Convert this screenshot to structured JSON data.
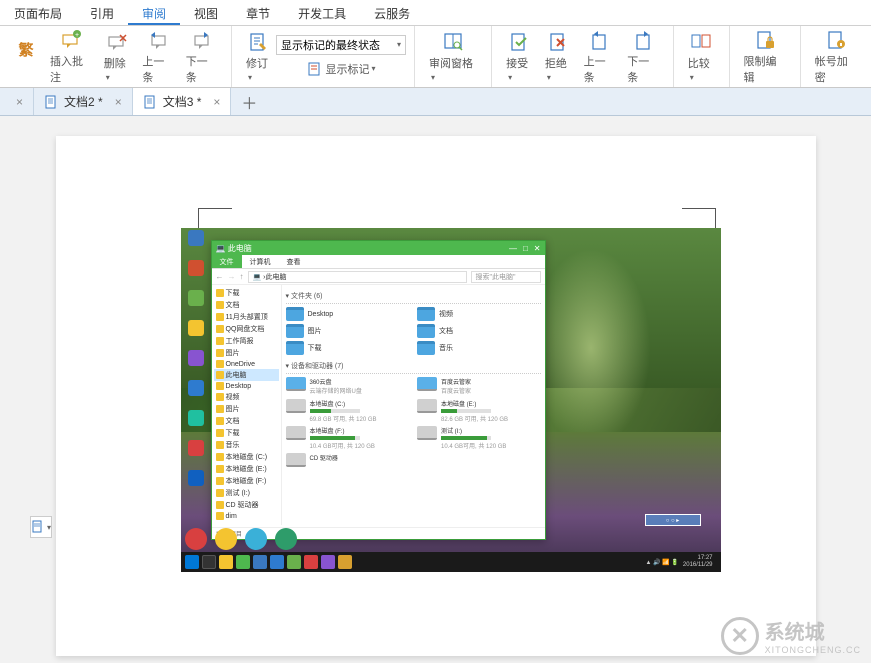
{
  "menu": {
    "items": [
      "页面布局",
      "引用",
      "审阅",
      "视图",
      "章节",
      "开发工具",
      "云服务"
    ],
    "active_index": 2
  },
  "ribbon": {
    "annotate_group": {
      "jianfan": "繁",
      "insert": "插入批注",
      "delete": "删除",
      "prev": "上一条",
      "next": "下一条"
    },
    "track_group": {
      "revise": "修订",
      "markup_state": "显示标记的最终状态",
      "show_markup": "显示标记"
    },
    "pane_group": {
      "review_pane": "审阅窗格"
    },
    "change_group": {
      "accept": "接受",
      "reject": "拒绝",
      "prev": "上一条",
      "next": "下一条"
    },
    "compare_group": {
      "compare": "比较"
    },
    "protect_group": {
      "restrict": "限制编辑"
    },
    "account_group": {
      "encrypt": "帐号加密"
    }
  },
  "tabs": [
    {
      "label": "",
      "close": true
    },
    {
      "label": "文档2 *",
      "close": true
    },
    {
      "label": "文档3 *",
      "close": true,
      "active": true
    }
  ],
  "explorer": {
    "title": "此电脑",
    "file_tabs": [
      "文件",
      "计算机",
      "查看"
    ],
    "path": "此电脑",
    "search_placeholder": "搜索\"此电脑\"",
    "nav": [
      "下载",
      "文档",
      "11月头部置顶",
      "QQ网盘文档",
      "工作简报",
      "图片",
      "OneDrive",
      "此电脑",
      "Desktop",
      "视频",
      "图片",
      "文档",
      "下载",
      "音乐",
      "本地磁盘 (C:)",
      "本地磁盘 (E:)",
      "本地磁盘 (F:)",
      "测试 (I:)",
      "CD 驱动器",
      "dim"
    ],
    "nav_selected_index": 7,
    "folders_header": "文件夹 (6)",
    "folders": [
      "Desktop",
      "视频",
      "图片",
      "文档",
      "下载",
      "音乐"
    ],
    "devices_header": "设备和驱动器 (7)",
    "clouds": [
      {
        "name": "360云盘",
        "sub": "云端存储的网络U盘"
      },
      {
        "name": "百度云管家",
        "sub": "百度云管家"
      }
    ],
    "drives": [
      {
        "name": "本地磁盘 (C:)",
        "info": "69.8 GB 可用, 共 120 GB",
        "fill": 42
      },
      {
        "name": "本地磁盘 (E:)",
        "info": "82.6 GB 可用, 共 120 GB",
        "fill": 31
      },
      {
        "name": "本地磁盘 (F:)",
        "info": "10.4 GB可用, 共 120 GB",
        "fill": 91
      },
      {
        "name": "测试 (I:)",
        "info": "10.4 GB可用, 共 120 GB",
        "fill": 91
      },
      {
        "name": "CD 驱动器",
        "info": "",
        "fill": 0
      }
    ],
    "status": "13 个项目"
  },
  "taskbar": {
    "time": "17:27",
    "date": "2016/11/29"
  },
  "watermark": {
    "text": "系统城",
    "sub": "XITONGCHENG.CC"
  }
}
